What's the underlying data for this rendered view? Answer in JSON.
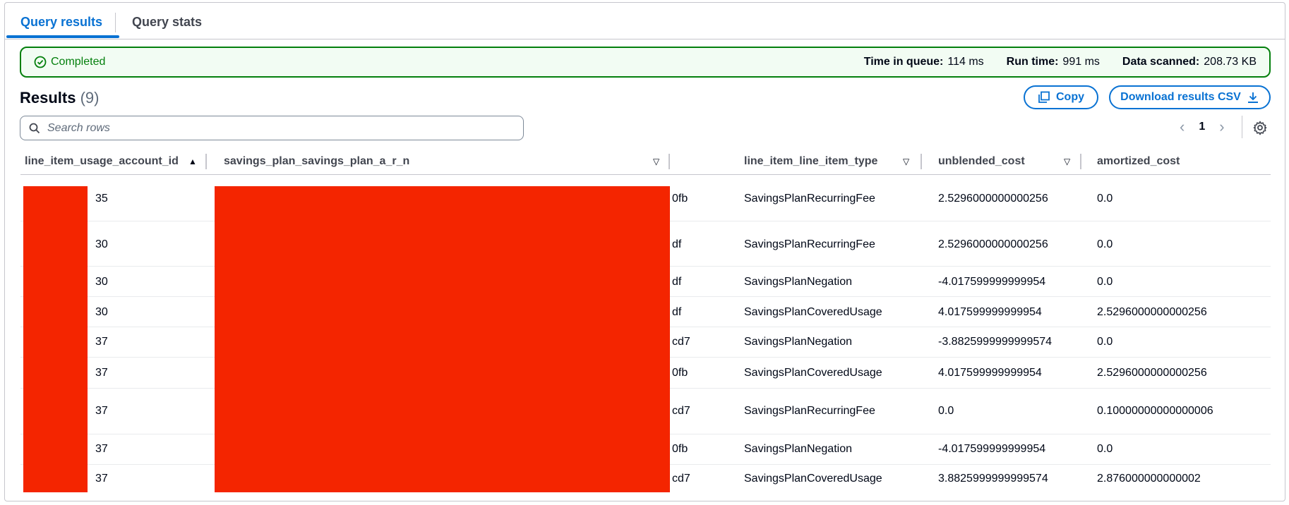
{
  "tabs": [
    {
      "label": "Query results",
      "active": true
    },
    {
      "label": "Query stats",
      "active": false
    }
  ],
  "status": {
    "label": "Completed",
    "time_in_queue_label": "Time in queue:",
    "time_in_queue": "114 ms",
    "run_time_label": "Run time:",
    "run_time": "991 ms",
    "data_scanned_label": "Data scanned:",
    "data_scanned": "208.73 KB"
  },
  "results": {
    "title": "Results",
    "count": "(9)",
    "copy_label": "Copy",
    "download_label": "Download results CSV",
    "search_placeholder": "Search rows",
    "page": "1"
  },
  "columns": [
    "line_item_usage_account_id",
    "savings_plan_savings_plan_a_r_n",
    "line_item_line_item_type",
    "unblended_cost",
    "amortized_cost"
  ],
  "rows": [
    {
      "account": "35",
      "arn": "0fb",
      "type": "SavingsPlanRecurringFee",
      "unblended": "2.5296000000000256",
      "amortized": "0.0"
    },
    {
      "account": "30",
      "arn": "df",
      "type": "SavingsPlanRecurringFee",
      "unblended": "2.5296000000000256",
      "amortized": "0.0"
    },
    {
      "account": "30",
      "arn": "df",
      "type": "SavingsPlanNegation",
      "unblended": "-4.017599999999954",
      "amortized": "0.0"
    },
    {
      "account": "30",
      "arn": "df",
      "type": "SavingsPlanCoveredUsage",
      "unblended": "4.017599999999954",
      "amortized": "2.5296000000000256"
    },
    {
      "account": "37",
      "arn": "cd7",
      "type": "SavingsPlanNegation",
      "unblended": "-3.8825999999999574",
      "amortized": "0.0"
    },
    {
      "account": "37",
      "arn": "0fb",
      "type": "SavingsPlanCoveredUsage",
      "unblended": "4.017599999999954",
      "amortized": "2.5296000000000256"
    },
    {
      "account": "37",
      "arn": "cd7",
      "type": "SavingsPlanRecurringFee",
      "unblended": "0.0",
      "amortized": "0.10000000000000006"
    },
    {
      "account": "37",
      "arn": "0fb",
      "type": "SavingsPlanNegation",
      "unblended": "-4.017599999999954",
      "amortized": "0.0"
    },
    {
      "account": "37",
      "arn": "cd7",
      "type": "SavingsPlanCoveredUsage",
      "unblended": "3.8825999999999574",
      "amortized": "2.876000000000002"
    }
  ]
}
